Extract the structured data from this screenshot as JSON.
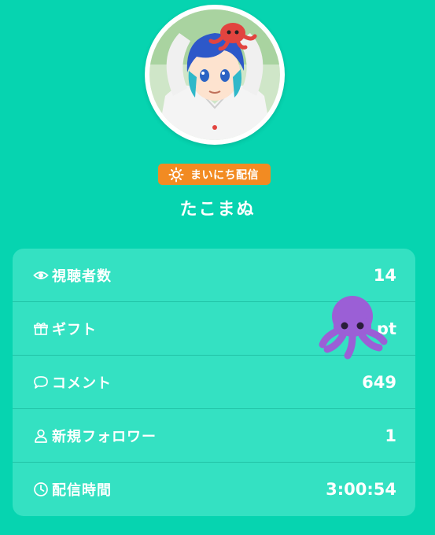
{
  "profile": {
    "name": "たこまぬ",
    "badge_label": "まいにち配信",
    "badge_color": "#f28b22"
  },
  "stats": [
    {
      "id": "viewers",
      "icon": "eye-icon",
      "label": "視聴者数",
      "value": "14"
    },
    {
      "id": "gifts",
      "icon": "gift-icon",
      "label": "ギフト",
      "value": "pt"
    },
    {
      "id": "comments",
      "icon": "comment-icon",
      "label": "コメント",
      "value": "649"
    },
    {
      "id": "followers",
      "icon": "person-icon",
      "label": "新規フォロワー",
      "value": "1"
    },
    {
      "id": "duration",
      "icon": "clock-icon",
      "label": "配信時間",
      "value": "3:00:54"
    }
  ],
  "overlay_icon": "octopus-emoji",
  "colors": {
    "background": "#06d4b0",
    "card": "#34e1c2",
    "octopus": "#9b5fd6"
  }
}
